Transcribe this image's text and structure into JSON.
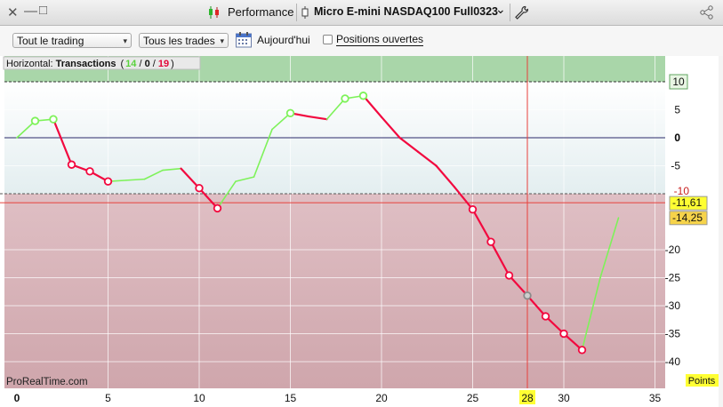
{
  "window": {
    "close_glyph": "✕",
    "minimize_glyph": "—",
    "maximize_glyph": "□",
    "app_title": "Performance",
    "instrument": "Micro E-mini NASDAQ100 Full0323",
    "instrument_caret": "⌄"
  },
  "toolbar": {
    "account_select": "Tout le trading",
    "trades_select": "Tous les trades",
    "date_label": "Aujourd'hui",
    "open_positions_label": "Positions ouvertes",
    "select_caret": "▾"
  },
  "panel": {
    "prefix": "Horizontal: ",
    "title": "Transactions",
    "open_paren": "(",
    "wins": "14",
    "sep1": " / ",
    "neutral": "0",
    "sep2": " / ",
    "losses": "19",
    "close_paren": ")",
    "brand": "ProRealTime.com",
    "unit_badge": "Points"
  },
  "colors": {
    "win": "#7ef25a",
    "loss": "#f2093f",
    "zone_top": "#a9d6a9",
    "zone_bottom": "#d6b2b8",
    "crosshair": "#e8403c",
    "badge": "#ffff33"
  },
  "crosshair": {
    "x_label": "28",
    "x_value": 28
  },
  "chart_data": {
    "type": "line",
    "title": "",
    "xlabel": "",
    "ylabel": "Points",
    "xlim": [
      0,
      35
    ],
    "ylim": [
      -45,
      14
    ],
    "x_ticks": [
      0,
      5,
      10,
      15,
      20,
      25,
      30,
      35
    ],
    "y_ticks": [
      5,
      0,
      -5,
      -20,
      -25,
      -30,
      -35,
      -40
    ],
    "grid": true,
    "levels": [
      {
        "name": "upper",
        "value": 10,
        "label": "10"
      },
      {
        "name": "zero",
        "value": 0,
        "label": "0"
      },
      {
        "name": "lower",
        "value": -10,
        "label": "-10"
      }
    ],
    "markers": [
      {
        "value": -11.61,
        "label": "-11,61"
      },
      {
        "value": -14.25,
        "label": "-14,25"
      }
    ],
    "x": [
      0,
      1,
      2,
      3,
      4,
      5,
      6,
      7,
      8,
      9,
      10,
      11,
      12,
      13,
      14,
      15,
      16,
      17,
      18,
      19,
      20,
      21,
      22,
      23,
      24,
      25,
      26,
      27,
      28,
      29,
      30,
      31,
      32,
      33
    ],
    "y": [
      0,
      3,
      3.3,
      -4.8,
      -6,
      -7.8,
      -7.6,
      -7.4,
      -5.8,
      -5.5,
      -9,
      -12.6,
      -7.8,
      -7,
      1.5,
      4.4,
      3.8,
      3.3,
      7,
      7.5,
      3.7,
      0,
      -2.5,
      -5,
      -8.8,
      -12.8,
      -18.6,
      -24.6,
      -28.2,
      -31.9,
      -35,
      -37.9,
      -25,
      -14.3
    ],
    "markers_at": [
      1,
      2,
      3,
      4,
      5,
      10,
      11,
      15,
      18,
      19,
      25,
      26,
      27,
      28,
      29,
      30,
      31
    ],
    "highlight_index": 28
  }
}
